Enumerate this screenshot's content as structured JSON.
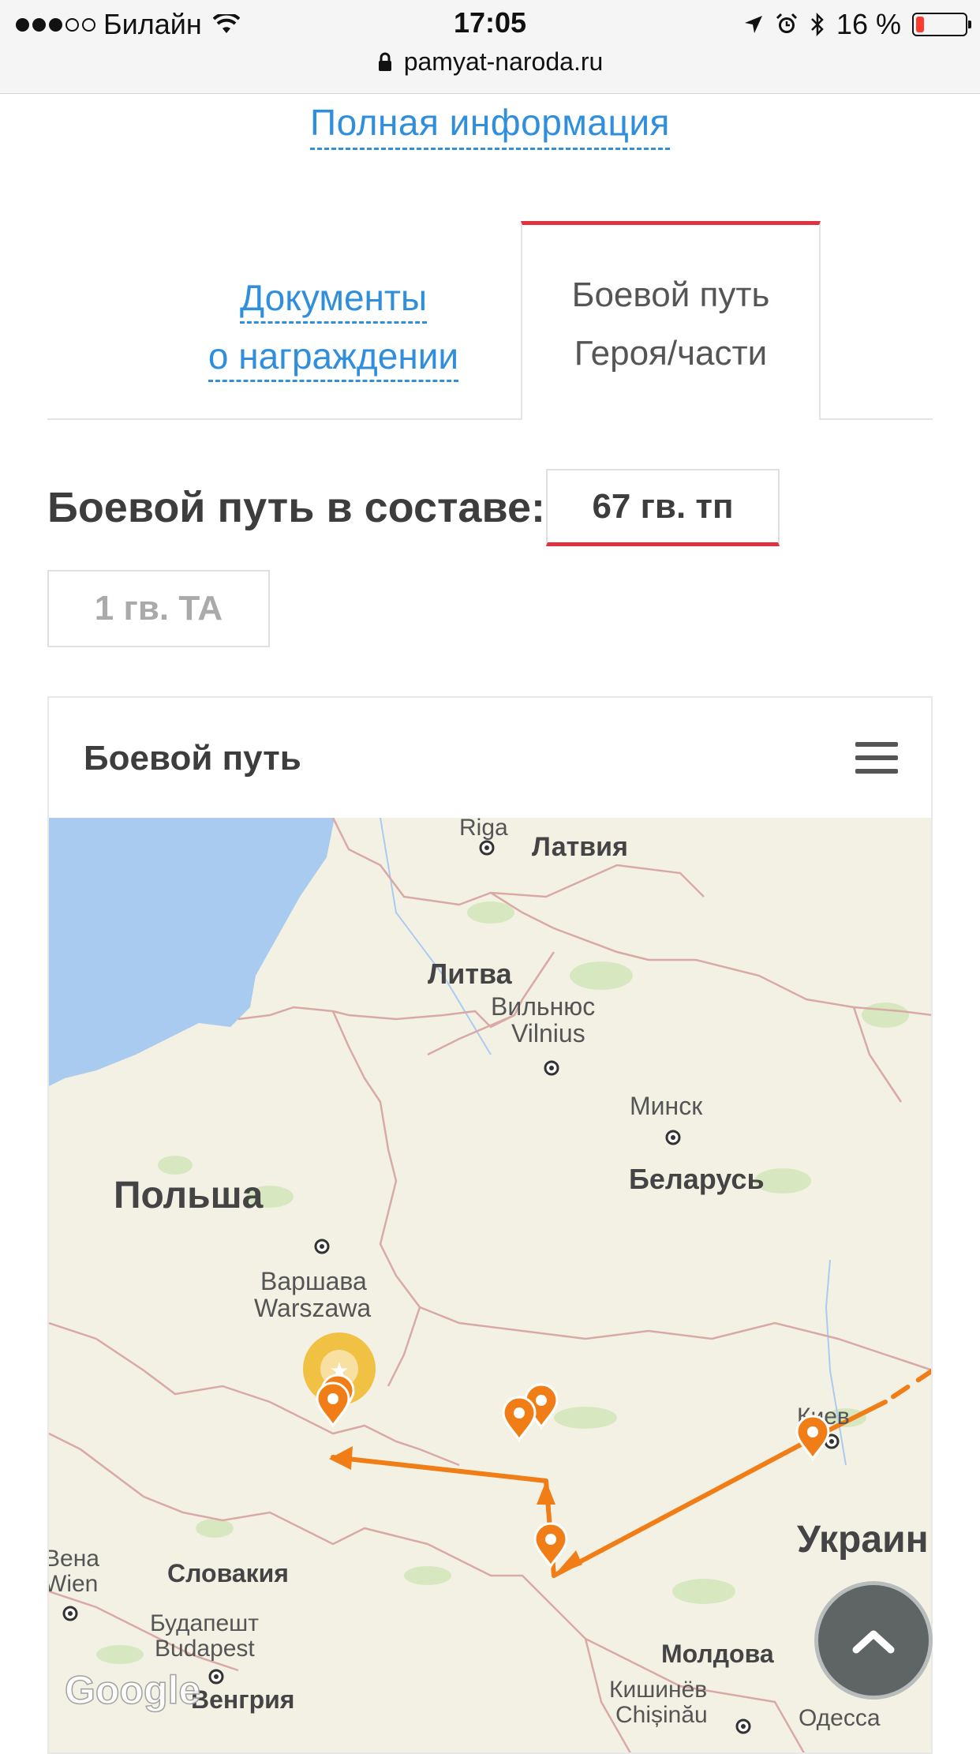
{
  "status_bar": {
    "carrier": "Билайн",
    "time": "17:05",
    "battery": "16 %",
    "battery_level": 0.16,
    "url": "pamyat-naroda.ru"
  },
  "full_info_link": "Полная информация",
  "tabs": [
    {
      "line1": "Документы",
      "line2": "о награждении",
      "active": false
    },
    {
      "line1": "Боевой путь",
      "line2": "Героя/части",
      "active": true
    }
  ],
  "combat_path_label": "Боевой путь в составе:",
  "unit_buttons": [
    {
      "label": "67 гв. тп",
      "active": true
    },
    {
      "label": "1 гв. ТА",
      "active": false
    }
  ],
  "map": {
    "title": "Боевой путь",
    "labels": {
      "riga": "Riga",
      "latvia": "Латвия",
      "lithuania": "Литва",
      "vilnius_ru": "Вильнюс",
      "vilnius": "Vilnius",
      "minsk": "Минск",
      "belarus": "Беларусь",
      "poland": "Польша",
      "warsaw_ru": "Варшава",
      "warsaw": "Warszawa",
      "kyiv": "Киев",
      "ukraine": "Украин",
      "vienna_ru": "Вена",
      "vienna": "Wien",
      "slovakia": "Словакия",
      "budapest_ru": "Будапешт",
      "budapest": "Budapest",
      "hungary": "Венгрия",
      "moldova": "Молдова",
      "chisinau_ru": "Кишинёв",
      "chisinau": "Chișinău",
      "odessa": "Одесса",
      "google": "Google"
    },
    "colors": {
      "route": "#f07d15",
      "water": "#aacbf0",
      "land": "#f3f1e4",
      "border": "#d9a9a6"
    }
  }
}
